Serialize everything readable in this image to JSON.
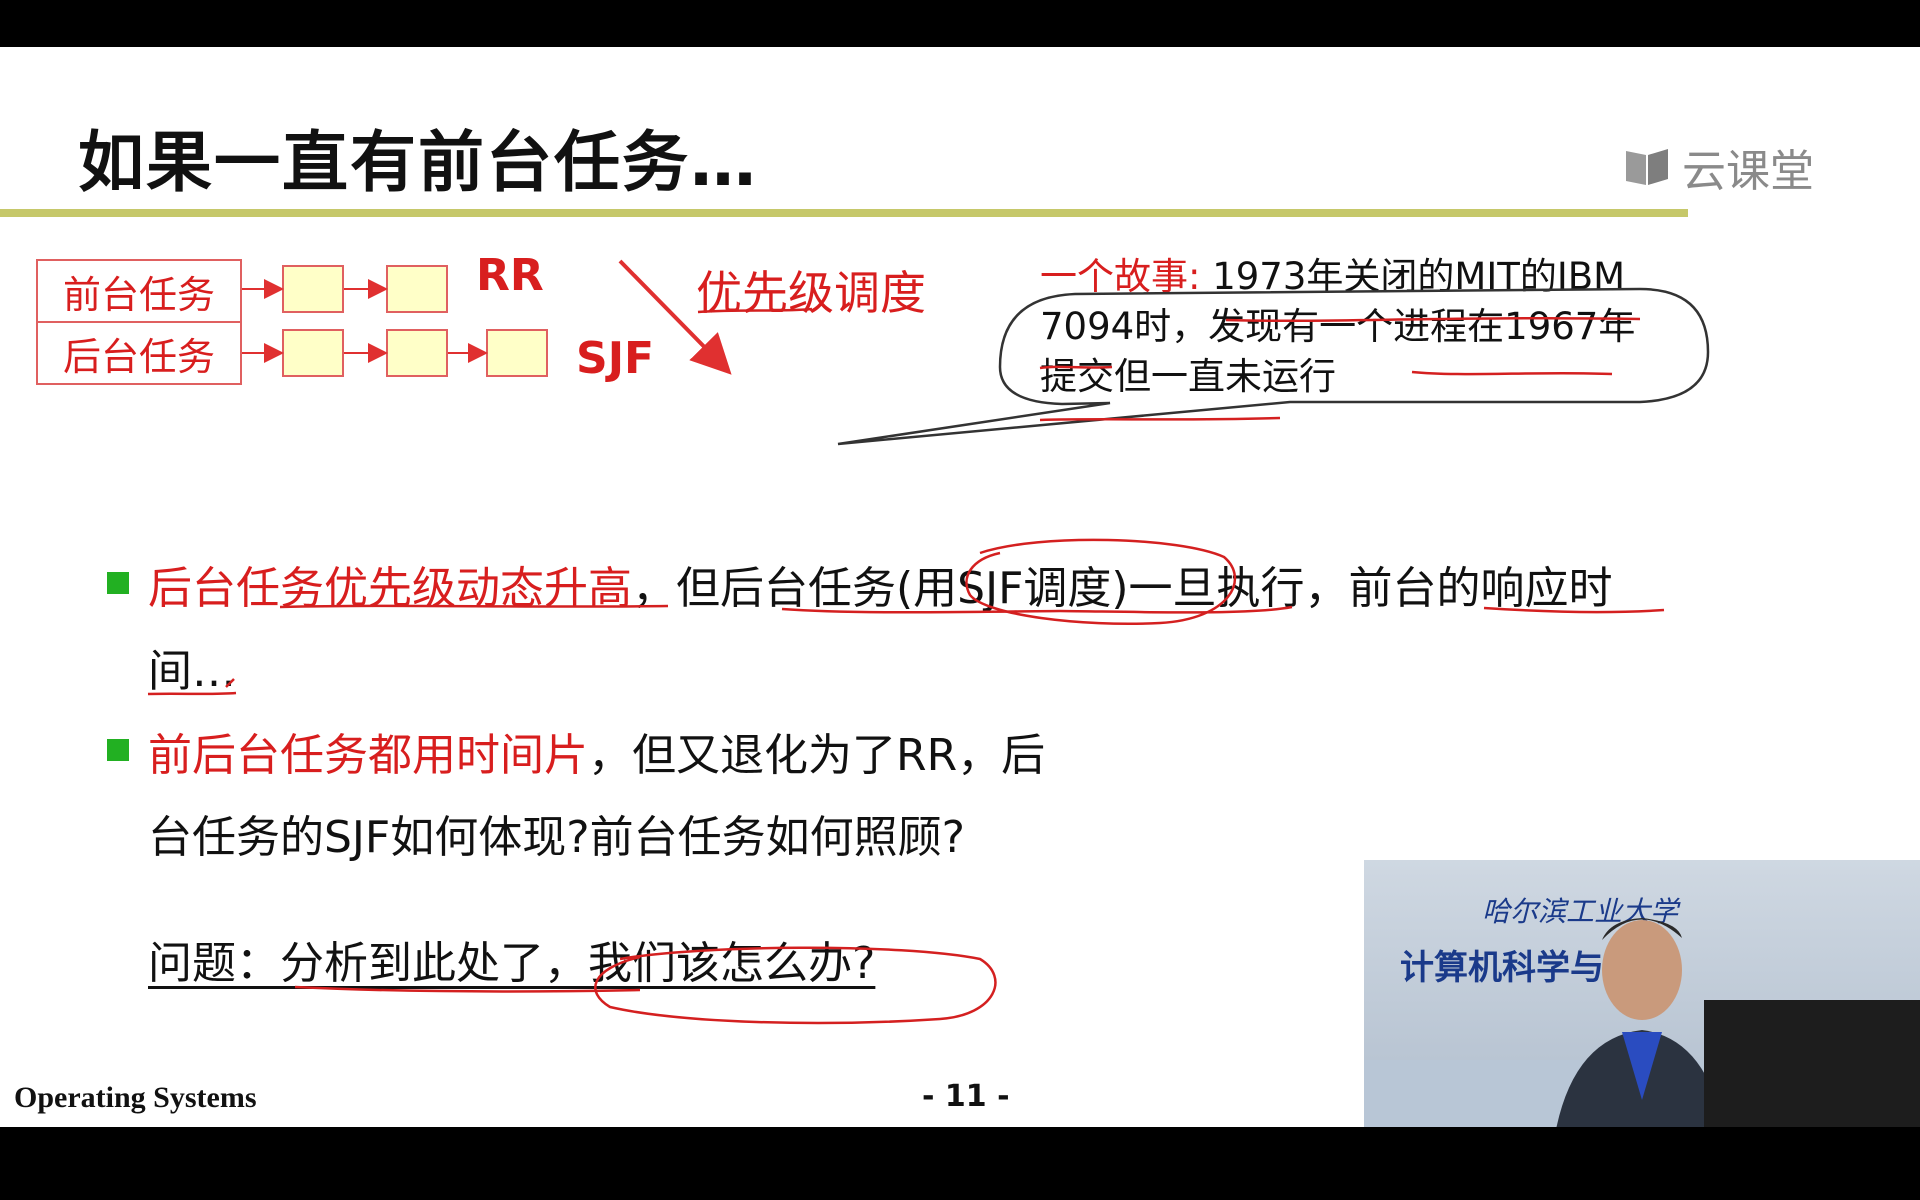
{
  "slide": {
    "title": "如果一直有前台任务…",
    "logo_text": "云课堂",
    "diagram": {
      "foreground_label": "前台任务",
      "background_label": "后台任务",
      "rr_label": "RR",
      "sjf_label": "SJF",
      "priority_label": "优先级调度"
    },
    "bubble": {
      "prefix": "一个故事:",
      "text1": " 1973年关闭的MIT的IBM",
      "text2": "7094时，发现有一个进程在1967年",
      "text3": "提交但一直未运行"
    },
    "bullets": [
      {
        "red_part": "后台任务优先级动态升高",
        "black_part": "，但后台任务(用SJF调度)一旦执行，前台的响应时",
        "continuation": "间…"
      },
      {
        "red_part": "前后台任务都用时间片",
        "black_part": "，但又退化为了RR，后",
        "continuation": "台任务的SJF如何体现?前台任务如何照顾?"
      }
    ],
    "question": "问题：分析到此处了，我们该怎么办?",
    "footer_left": "Operating Systems",
    "page_number": "- 11 -"
  },
  "video": {
    "university": "哈尔滨工业大学",
    "department": "计算机科学与技术"
  },
  "colors": {
    "accent_red": "#d81e1e",
    "rule": "#c6c86a",
    "bullet_green": "#22b022",
    "queue_box": "#ffffc8"
  }
}
